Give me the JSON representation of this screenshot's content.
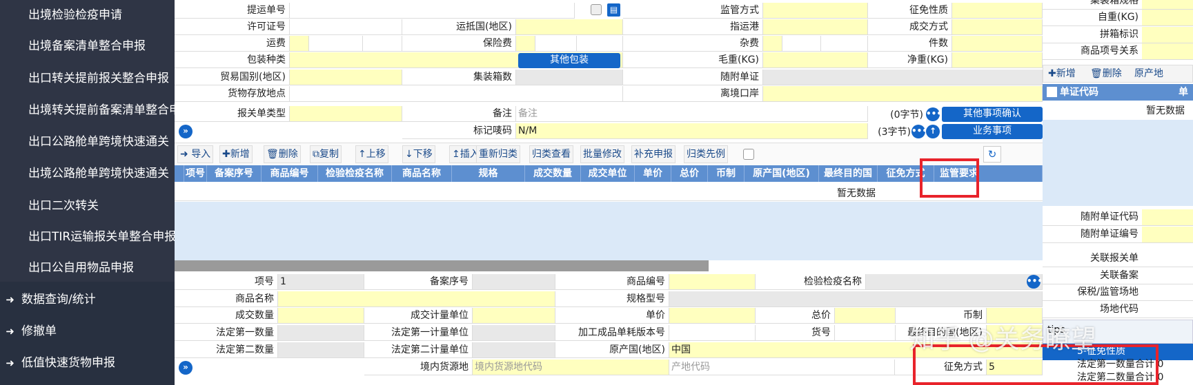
{
  "sidebar": {
    "items": [
      "出境检验检疫申请",
      "出境备案清单整合申报",
      "出口转关提前报关整合申报",
      "出境转关提前备案清单整合申报",
      "出口公路舱单跨境快速通关",
      "出境公路舱单跨境快速通关",
      "出口二次转关",
      "出口TIR运输报关单整合申报",
      "出口公自用物品申报"
    ],
    "sections": [
      {
        "label": "数据查询/统计",
        "icon": "sign-in-icon"
      },
      {
        "label": "修撤单",
        "icon": "sign-in-icon"
      },
      {
        "label": "低值快速货物申报",
        "icon": "sign-in-icon"
      }
    ]
  },
  "form": {
    "tiyundan": "提运单号",
    "jianguanfangshi": "监管方式",
    "zhengmianxingzhi": "征免性质",
    "xukezheng": "许可证号",
    "yundiguo": "运抵国(地区)",
    "zhiyungang": "指运港",
    "chengjiaofangshi": "成交方式",
    "yunfei": "运费",
    "baoxianfei": "保险费",
    "zafei": "杂费",
    "jianshu": "件数",
    "baozhuang": "包装种类",
    "qitabaozhuang": "其他包装",
    "maozhong": "毛重(KG)",
    "jingzhong": "净重(KG)",
    "maoyiguobie": "贸易国别(地区)",
    "jizhuangxiang": "集装箱数",
    "suifudanzheng": "随附单证",
    "huowucunfang": "货物存放地点",
    "lijingkouan": "离境口岸",
    "baoguandanleixing": "报关单类型",
    "beizhu": "备注",
    "beizhu_ph": "备注",
    "beizhu_count": "(0字节)",
    "qitashixiang": "其他事项确认",
    "biaojimatou": "标记唛码",
    "biaojimatou_val": "N/M",
    "biaoji_count": "(3字节)",
    "yewushixiang": "业务事项"
  },
  "toolbar": {
    "import": "导入",
    "add": "新增",
    "delete": "删除",
    "copy": "复制",
    "up": "上移",
    "down": "下移",
    "insert": "插入",
    "reclassify": "重新归类",
    "classview": "归类查看",
    "batch": "批量修改",
    "supplement": "补充申报",
    "precedent": "归类先例"
  },
  "grid": {
    "headers": [
      "项号",
      "备案序号",
      "商品编号",
      "检验检疫名称",
      "商品名称",
      "规格",
      "成交数量",
      "成交单位",
      "单价",
      "总价",
      "币制",
      "原产国(地区)",
      "最终目的国",
      "征免方式",
      "监管要求"
    ],
    "empty": "暂无数据"
  },
  "detail": {
    "xianghao": "项号",
    "xianghao_val": "1",
    "beianxuhao": "备案序号",
    "shangpinbianhao": "商品编号",
    "jianyanmingcheng": "检验检疫名称",
    "shangpinmingcheng": "商品名称",
    "guigexinghao": "规格型号",
    "chengjiaoshuliang": "成交数量",
    "chengjiaojiliang": "成交计量单位",
    "danjia": "单价",
    "zongjia": "总价",
    "bizhi": "币制",
    "fading1": "法定第一数量",
    "fading1unit": "法定第一计量单位",
    "jiagong": "加工成品单耗版本号",
    "huohao": "货号",
    "zuizhong": "最终目的国(地区)",
    "fading2": "法定第二数量",
    "fading2unit": "法定第二计量单位",
    "yuanchanguo": "原产国(地区)",
    "yuanchanguo_val": "中国",
    "jingneihuoyuan": "境内货源地",
    "jingneihuoyuan_ph": "境内货源地代码",
    "chandi_ph": "产地代码",
    "zhengmianfangshi": "征免方式",
    "zhengmianfangshi_val": "5"
  },
  "right": {
    "jizhuangxiangguige": "集装箱规格",
    "zizhong": "自重(KG)",
    "pinxiang": "拼箱标识",
    "shangpinguanxi": "商品项号关系",
    "add": "新增",
    "delete": "删除",
    "origin": "原产地",
    "danzhengdaima": "单证代码",
    "danzheng2": "单证",
    "empty": "暂无数据",
    "suifudaima": "随附单证代码",
    "suifubianhao": "随附单证编号",
    "guanlianbaoguan": "关联报关单",
    "guanlianbeian": "关联备案",
    "baoshui": "保税/监管场地",
    "changdi": "场地代码",
    "tips": "tips",
    "dropdown_option": "5-征免性质",
    "fading1total": "法定第一数量合计",
    "fading1total_val": "0",
    "fading2total": "法定第二数量合计",
    "fading2total_val": "0"
  },
  "watermark": "知乎 @关务瞭望",
  "colors": {
    "sidebar": "#2f3545",
    "header": "#5d8fd0",
    "required": "#ffffbf",
    "button": "#1466c8",
    "highlight": "#e8232b"
  }
}
